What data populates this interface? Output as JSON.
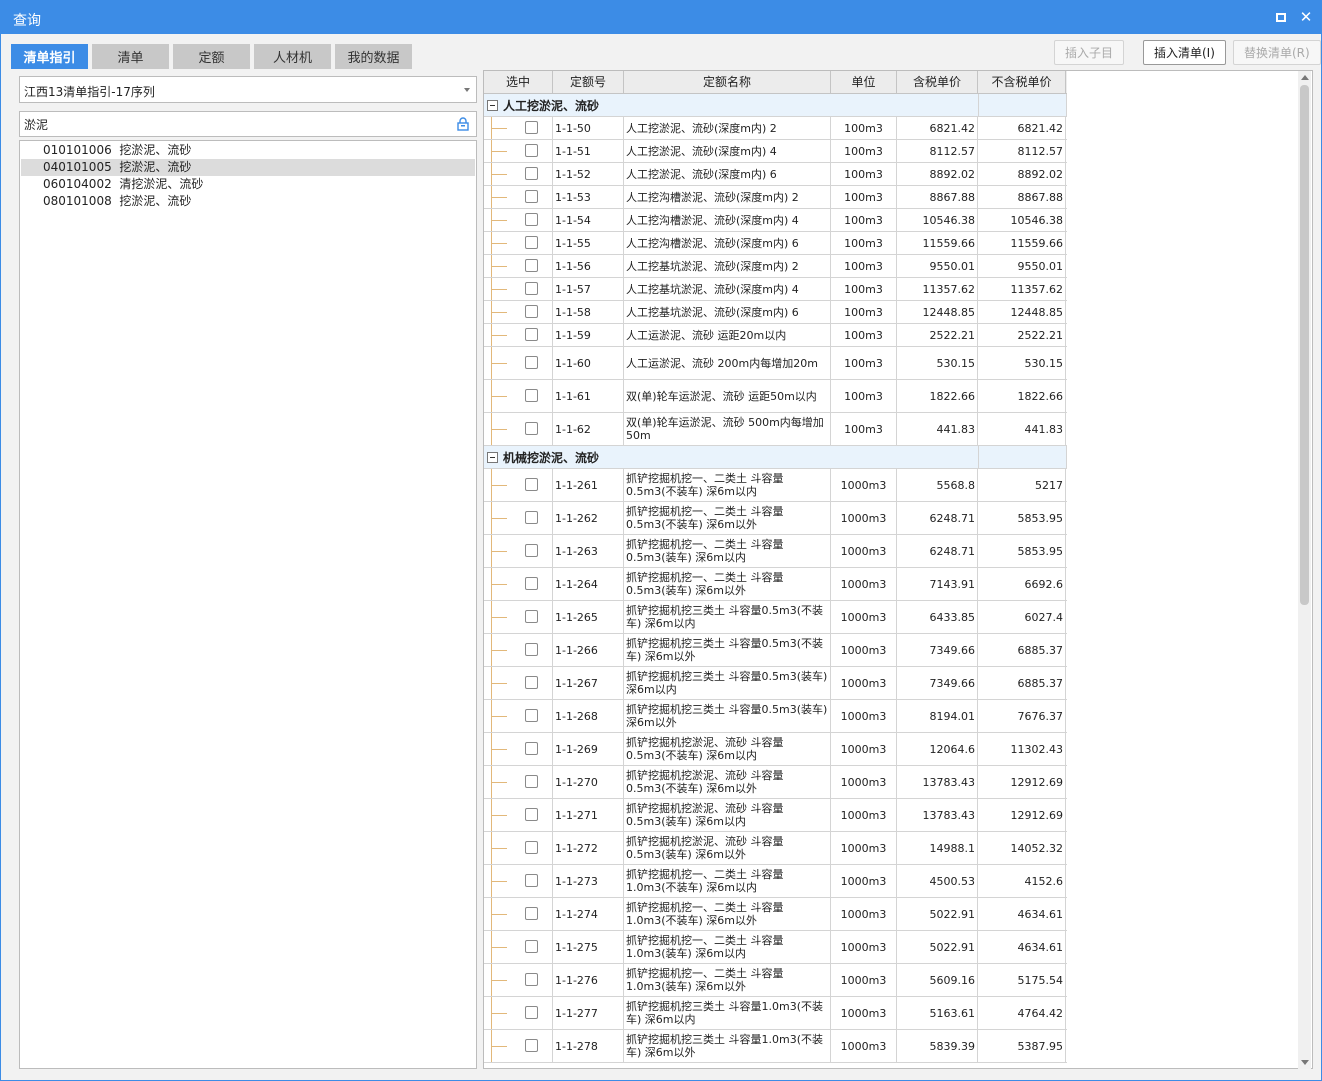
{
  "window": {
    "title": "查询"
  },
  "tabs": [
    {
      "label": "清单指引",
      "active": true
    },
    {
      "label": "清单",
      "active": false
    },
    {
      "label": "定额",
      "active": false
    },
    {
      "label": "人材机",
      "active": false
    },
    {
      "label": "我的数据",
      "active": false
    }
  ],
  "actions": {
    "insert_sub": "插入子目",
    "insert_list": "插入清单(I)",
    "replace_list": "替换清单(R)"
  },
  "left": {
    "library": "江西13清单指引-17序列",
    "search_value": "淤泥",
    "results": [
      {
        "code": "010101006",
        "name": "挖淤泥、流砂",
        "selected": false
      },
      {
        "code": "040101005",
        "name": "挖淤泥、流砂",
        "selected": true
      },
      {
        "code": "060104002",
        "name": "清挖淤泥、流砂",
        "selected": false
      },
      {
        "code": "080101008",
        "name": "挖淤泥、流砂",
        "selected": false
      }
    ]
  },
  "grid": {
    "columns": [
      "选中",
      "定额号",
      "定额名称",
      "单位",
      "含税单价",
      "不含税单价"
    ],
    "groups": [
      {
        "name": "人工挖淤泥、流砂",
        "rows": [
          {
            "code": "1-1-50",
            "name": "人工挖淤泥、流砂(深度m内) 2",
            "unit": "100m3",
            "price_tax": "6821.42",
            "price_notax": "6821.42"
          },
          {
            "code": "1-1-51",
            "name": "人工挖淤泥、流砂(深度m内) 4",
            "unit": "100m3",
            "price_tax": "8112.57",
            "price_notax": "8112.57"
          },
          {
            "code": "1-1-52",
            "name": "人工挖淤泥、流砂(深度m内) 6",
            "unit": "100m3",
            "price_tax": "8892.02",
            "price_notax": "8892.02"
          },
          {
            "code": "1-1-53",
            "name": "人工挖沟槽淤泥、流砂(深度m内) 2",
            "unit": "100m3",
            "price_tax": "8867.88",
            "price_notax": "8867.88"
          },
          {
            "code": "1-1-54",
            "name": "人工挖沟槽淤泥、流砂(深度m内) 4",
            "unit": "100m3",
            "price_tax": "10546.38",
            "price_notax": "10546.38"
          },
          {
            "code": "1-1-55",
            "name": "人工挖沟槽淤泥、流砂(深度m内) 6",
            "unit": "100m3",
            "price_tax": "11559.66",
            "price_notax": "11559.66"
          },
          {
            "code": "1-1-56",
            "name": "人工挖基坑淤泥、流砂(深度m内) 2",
            "unit": "100m3",
            "price_tax": "9550.01",
            "price_notax": "9550.01"
          },
          {
            "code": "1-1-57",
            "name": "人工挖基坑淤泥、流砂(深度m内) 4",
            "unit": "100m3",
            "price_tax": "11357.62",
            "price_notax": "11357.62"
          },
          {
            "code": "1-1-58",
            "name": "人工挖基坑淤泥、流砂(深度m内) 6",
            "unit": "100m3",
            "price_tax": "12448.85",
            "price_notax": "12448.85"
          },
          {
            "code": "1-1-59",
            "name": "人工运淤泥、流砂 运距20m以内",
            "unit": "100m3",
            "price_tax": "2522.21",
            "price_notax": "2522.21"
          },
          {
            "code": "1-1-60",
            "name": "人工运淤泥、流砂 200m内每增加20m",
            "unit": "100m3",
            "price_tax": "530.15",
            "price_notax": "530.15"
          },
          {
            "code": "1-1-61",
            "name": "双(单)轮车运淤泥、流砂 运距50m以内",
            "unit": "100m3",
            "price_tax": "1822.66",
            "price_notax": "1822.66"
          },
          {
            "code": "1-1-62",
            "name": "双(单)轮车运淤泥、流砂 500m内每增加50m",
            "unit": "100m3",
            "price_tax": "441.83",
            "price_notax": "441.83"
          }
        ]
      },
      {
        "name": "机械挖淤泥、流砂",
        "rows": [
          {
            "code": "1-1-261",
            "name": "抓铲挖掘机挖一、二类土 斗容量0.5m3(不装车) 深6m以内",
            "unit": "1000m3",
            "price_tax": "5568.8",
            "price_notax": "5217"
          },
          {
            "code": "1-1-262",
            "name": "抓铲挖掘机挖一、二类土 斗容量0.5m3(不装车) 深6m以外",
            "unit": "1000m3",
            "price_tax": "6248.71",
            "price_notax": "5853.95"
          },
          {
            "code": "1-1-263",
            "name": "抓铲挖掘机挖一、二类土 斗容量0.5m3(装车) 深6m以内",
            "unit": "1000m3",
            "price_tax": "6248.71",
            "price_notax": "5853.95"
          },
          {
            "code": "1-1-264",
            "name": "抓铲挖掘机挖一、二类土 斗容量0.5m3(装车) 深6m以外",
            "unit": "1000m3",
            "price_tax": "7143.91",
            "price_notax": "6692.6"
          },
          {
            "code": "1-1-265",
            "name": "抓铲挖掘机挖三类土 斗容量0.5m3(不装车) 深6m以内",
            "unit": "1000m3",
            "price_tax": "6433.85",
            "price_notax": "6027.4"
          },
          {
            "code": "1-1-266",
            "name": "抓铲挖掘机挖三类土 斗容量0.5m3(不装车) 深6m以外",
            "unit": "1000m3",
            "price_tax": "7349.66",
            "price_notax": "6885.37"
          },
          {
            "code": "1-1-267",
            "name": "抓铲挖掘机挖三类土 斗容量0.5m3(装车) 深6m以内",
            "unit": "1000m3",
            "price_tax": "7349.66",
            "price_notax": "6885.37"
          },
          {
            "code": "1-1-268",
            "name": "抓铲挖掘机挖三类土 斗容量0.5m3(装车) 深6m以外",
            "unit": "1000m3",
            "price_tax": "8194.01",
            "price_notax": "7676.37"
          },
          {
            "code": "1-1-269",
            "name": "抓铲挖掘机挖淤泥、流砂 斗容量0.5m3(不装车) 深6m以内",
            "unit": "1000m3",
            "price_tax": "12064.6",
            "price_notax": "11302.43"
          },
          {
            "code": "1-1-270",
            "name": "抓铲挖掘机挖淤泥、流砂 斗容量0.5m3(不装车) 深6m以外",
            "unit": "1000m3",
            "price_tax": "13783.43",
            "price_notax": "12912.69"
          },
          {
            "code": "1-1-271",
            "name": "抓铲挖掘机挖淤泥、流砂 斗容量0.5m3(装车) 深6m以内",
            "unit": "1000m3",
            "price_tax": "13783.43",
            "price_notax": "12912.69"
          },
          {
            "code": "1-1-272",
            "name": "抓铲挖掘机挖淤泥、流砂 斗容量0.5m3(装车) 深6m以外",
            "unit": "1000m3",
            "price_tax": "14988.1",
            "price_notax": "14052.32"
          },
          {
            "code": "1-1-273",
            "name": "抓铲挖掘机挖一、二类土 斗容量1.0m3(不装车) 深6m以内",
            "unit": "1000m3",
            "price_tax": "4500.53",
            "price_notax": "4152.6"
          },
          {
            "code": "1-1-274",
            "name": "抓铲挖掘机挖一、二类土 斗容量1.0m3(不装车) 深6m以外",
            "unit": "1000m3",
            "price_tax": "5022.91",
            "price_notax": "4634.61"
          },
          {
            "code": "1-1-275",
            "name": "抓铲挖掘机挖一、二类土 斗容量1.0m3(装车) 深6m以内",
            "unit": "1000m3",
            "price_tax": "5022.91",
            "price_notax": "4634.61"
          },
          {
            "code": "1-1-276",
            "name": "抓铲挖掘机挖一、二类土 斗容量1.0m3(装车) 深6m以外",
            "unit": "1000m3",
            "price_tax": "5609.16",
            "price_notax": "5175.54"
          },
          {
            "code": "1-1-277",
            "name": "抓铲挖掘机挖三类土 斗容量1.0m3(不装车) 深6m以内",
            "unit": "1000m3",
            "price_tax": "5163.61",
            "price_notax": "4764.42"
          },
          {
            "code": "1-1-278",
            "name": "抓铲挖掘机挖三类土 斗容量1.0m3(不装车) 深6m以外",
            "unit": "1000m3",
            "price_tax": "5839.39",
            "price_notax": "5387.95"
          }
        ]
      }
    ]
  },
  "colors": {
    "accent": "#3c8ce6",
    "group_bg": "#e9f3fc",
    "tree_line": "#e2b87a"
  }
}
